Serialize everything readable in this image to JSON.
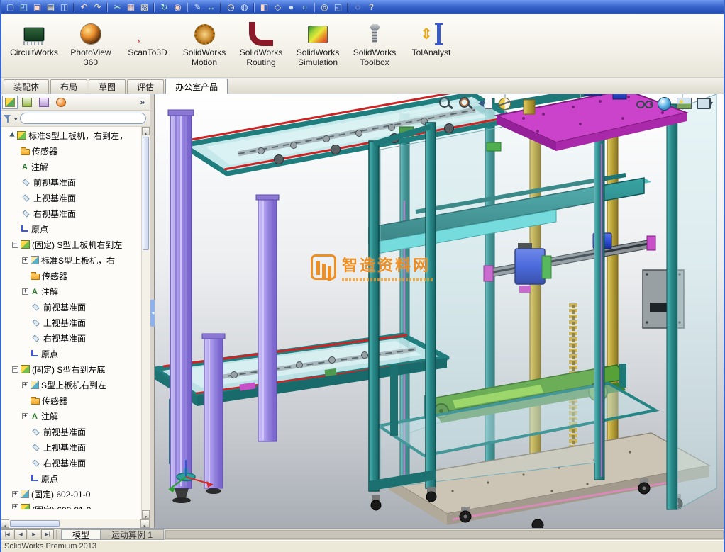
{
  "colors": {
    "titlebar_blue": "#3a66cc",
    "machine_teal": "#2a8f8f",
    "machine_magenta": "#cb42cb",
    "machine_purple": "#a896ec",
    "machine_gold": "#bfa93c",
    "machine_blue": "#2f4fd8",
    "watermark_orange": "#ef8a1a"
  },
  "standard_toolbar": {
    "groups": [
      [
        "new",
        "open",
        "save",
        "print",
        "print-preview"
      ],
      [
        "undo",
        "redo"
      ],
      [
        "cut",
        "copy",
        "paste"
      ],
      [
        "rebuild",
        "edit-appearance"
      ],
      [
        "sketch",
        "smart-dimension"
      ],
      [
        "measure",
        "mass-properties"
      ],
      [
        "section-view",
        "view-orientation",
        "shaded-view",
        "wireframe-view"
      ],
      [
        "zoom-fit",
        "zoom-area"
      ],
      [
        "search",
        "help"
      ]
    ]
  },
  "ribbon": {
    "buttons": [
      {
        "id": "circuitworks",
        "label": "CircuitWorks"
      },
      {
        "id": "photoview360",
        "label": "PhotoView 360"
      },
      {
        "id": "scanto3d",
        "label": "ScanTo3D"
      },
      {
        "id": "motion",
        "label": "SolidWorks Motion"
      },
      {
        "id": "routing",
        "label": "SolidWorks Routing"
      },
      {
        "id": "simulation",
        "label": "SolidWorks Simulation"
      },
      {
        "id": "toolbox",
        "label": "SolidWorks Toolbox"
      },
      {
        "id": "tolanalyst",
        "label": "TolAnalyst"
      }
    ]
  },
  "command_tabs": [
    {
      "label": "装配体",
      "active": false
    },
    {
      "label": "布局",
      "active": false
    },
    {
      "label": "草图",
      "active": false
    },
    {
      "label": "评估",
      "active": false
    },
    {
      "label": "办公室产品",
      "active": true
    }
  ],
  "feature_panel": {
    "tabs": [
      "featuremanager-tree",
      "propertymanager",
      "configuration-manager",
      "display-manager"
    ],
    "overflow": "»",
    "filter_placeholder": "",
    "tree": [
      {
        "label": "标准S型上板机，右到左，",
        "icon": "assembly",
        "level": 0,
        "expander": "none",
        "prefix": "arrow"
      },
      {
        "label": "传感器",
        "icon": "folder",
        "level": 1,
        "expander": "none"
      },
      {
        "label": "注解",
        "icon": "annotation",
        "level": 1,
        "expander": "none"
      },
      {
        "label": "前视基准面",
        "icon": "plane",
        "level": 1,
        "expander": "none"
      },
      {
        "label": "上视基准面",
        "icon": "plane",
        "level": 1,
        "expander": "none"
      },
      {
        "label": "右视基准面",
        "icon": "plane",
        "level": 1,
        "expander": "none"
      },
      {
        "label": "原点",
        "icon": "origin",
        "level": 1,
        "expander": "none"
      },
      {
        "label": "(固定) S型上板机右到左",
        "icon": "assembly",
        "level": 1,
        "expander": "minus"
      },
      {
        "label": "标准S型上板机，右",
        "icon": "part",
        "level": 2,
        "expander": "plus"
      },
      {
        "label": "传感器",
        "icon": "folder",
        "level": 2,
        "expander": "none"
      },
      {
        "label": "注解",
        "icon": "annotation",
        "level": 2,
        "expander": "plus"
      },
      {
        "label": "前视基准面",
        "icon": "plane",
        "level": 2,
        "expander": "none"
      },
      {
        "label": "上视基准面",
        "icon": "plane",
        "level": 2,
        "expander": "none"
      },
      {
        "label": "右视基准面",
        "icon": "plane",
        "level": 2,
        "expander": "none"
      },
      {
        "label": "原点",
        "icon": "origin",
        "level": 2,
        "expander": "none"
      },
      {
        "label": "(固定) S型右到左底",
        "icon": "assembly",
        "level": 1,
        "expander": "minus"
      },
      {
        "label": "S型上板机右到左",
        "icon": "part",
        "level": 2,
        "expander": "plus"
      },
      {
        "label": "传感器",
        "icon": "folder",
        "level": 2,
        "expander": "none"
      },
      {
        "label": "注解",
        "icon": "annotation",
        "level": 2,
        "expander": "plus"
      },
      {
        "label": "前视基准面",
        "icon": "plane",
        "level": 2,
        "expander": "none"
      },
      {
        "label": "上视基准面",
        "icon": "plane",
        "level": 2,
        "expander": "none"
      },
      {
        "label": "右视基准面",
        "icon": "plane",
        "level": 2,
        "expander": "none"
      },
      {
        "label": "原点",
        "icon": "origin",
        "level": 2,
        "expander": "none"
      },
      {
        "label": "(固定) 602-01-0",
        "icon": "part",
        "level": 1,
        "expander": "plus"
      },
      {
        "label": "(固定) 602-01-0",
        "icon": "assembly",
        "level": 1,
        "expander": "plus",
        "clipped": true
      }
    ]
  },
  "viewport": {
    "heads_up_left": [
      "zoom-fit",
      "zoom-to-area",
      "previous-view",
      "section-view"
    ],
    "heads_up_right": [
      "hide-show-items",
      "edit-appearance",
      "apply-scene",
      "view-settings"
    ],
    "watermark": {
      "text": "智造资料网"
    }
  },
  "motion_bar": {
    "nav": [
      "first",
      "prev",
      "next",
      "last"
    ],
    "tabs": [
      {
        "label": "模型",
        "active": true
      },
      {
        "label": "运动算例 1",
        "active": false
      }
    ]
  },
  "status_bar": {
    "text": "SolidWorks Premium 2013"
  }
}
